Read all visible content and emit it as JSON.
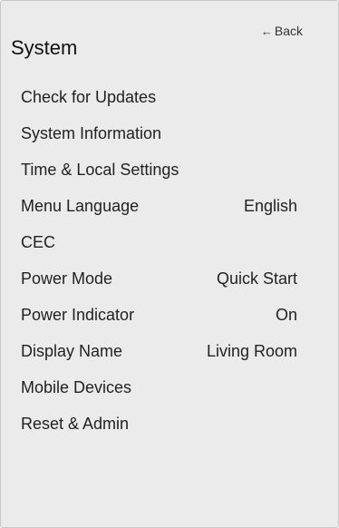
{
  "header": {
    "title": "System",
    "back_label": "Back",
    "back_icon": "arrow-left-icon"
  },
  "menu": {
    "items": [
      {
        "label": "Check for Updates",
        "value": ""
      },
      {
        "label": "System Information",
        "value": ""
      },
      {
        "label": "Time & Local Settings",
        "value": ""
      },
      {
        "label": "Menu Language",
        "value": "English"
      },
      {
        "label": "CEC",
        "value": ""
      },
      {
        "label": "Power Mode",
        "value": "Quick Start"
      },
      {
        "label": "Power Indicator",
        "value": "On"
      },
      {
        "label": "Display Name",
        "value": "Living Room"
      },
      {
        "label": "Mobile Devices",
        "value": ""
      },
      {
        "label": "Reset & Admin",
        "value": ""
      }
    ]
  },
  "colors": {
    "panel_background": "#ebebeb",
    "text": "#222222"
  }
}
